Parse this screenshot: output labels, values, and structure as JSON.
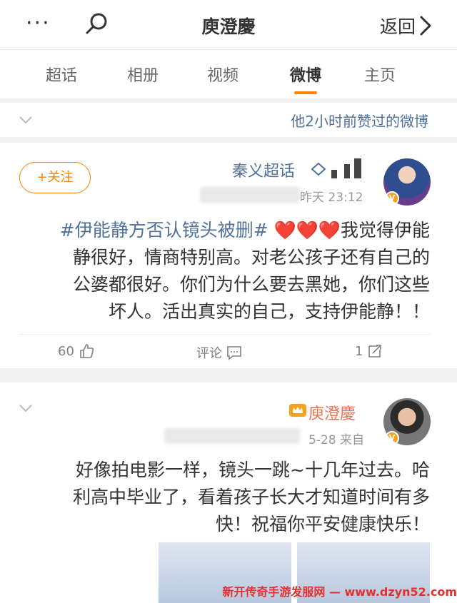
{
  "header": {
    "more_label": "···",
    "title": "庾澄慶",
    "back_label": "返回"
  },
  "tabs": [
    {
      "label": "主页"
    },
    {
      "label": "微博"
    },
    {
      "label": "视频"
    },
    {
      "label": "相册"
    },
    {
      "label": "超话"
    }
  ],
  "liked_bar": {
    "text": "他2小时前赞过的微博"
  },
  "post1": {
    "follow_label": "+关注",
    "username": "秦义超话",
    "time": "昨天 23:12",
    "lines": [
      "#伊能静方否认镜头被删# ❤️❤️❤️我觉得伊能",
      "静很好，情商特别高。对老公孩子还有自己的",
      "公婆都很好。你们为什么要去黑她，你们这些",
      "坏人。活出真实的自己，支持伊能静！！"
    ],
    "hashtag": "#伊能静方否认镜头被删#",
    "like_count": "60",
    "comment_label": "评论",
    "repost_count": "1"
  },
  "post2": {
    "username": "庾澄慶",
    "time": "5-28 来自",
    "lines": [
      "好像拍电影一样，镜头一跳~十几年过去。哈",
      "利高中毕业了，看着孩子长大才知道时间有多",
      "快！祝福你平安健康快乐！"
    ]
  },
  "watermark": "新开传奇手游发服网 — www.dzyn52.com",
  "colors": {
    "accent": "#ff8200",
    "link": "#50729b",
    "name": "#eb7350"
  }
}
